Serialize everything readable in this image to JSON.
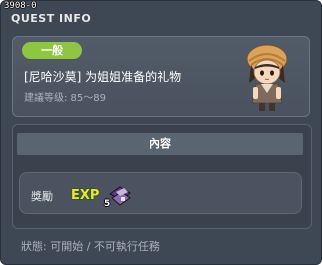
{
  "window": {
    "quest_id": "3908-0",
    "title": "QUEST INFO"
  },
  "quest": {
    "category": "一般",
    "name": "[尼哈沙莫] 为姐姐准备的礼物",
    "level_label": "建議等级: 85～89",
    "npc_icon": "npc-portrait"
  },
  "content": {
    "header": "內容",
    "reward_label": "獎勵",
    "exp_icon_label": "EXP",
    "item_icon": "item-icon",
    "item_quantity": "5"
  },
  "status": {
    "text": "狀態: 可開始 / 不可執行任務"
  },
  "colors": {
    "window_bg": "#3e4754",
    "badge_green": "#8ec63f",
    "exp_yellow": "#f2e52a"
  }
}
